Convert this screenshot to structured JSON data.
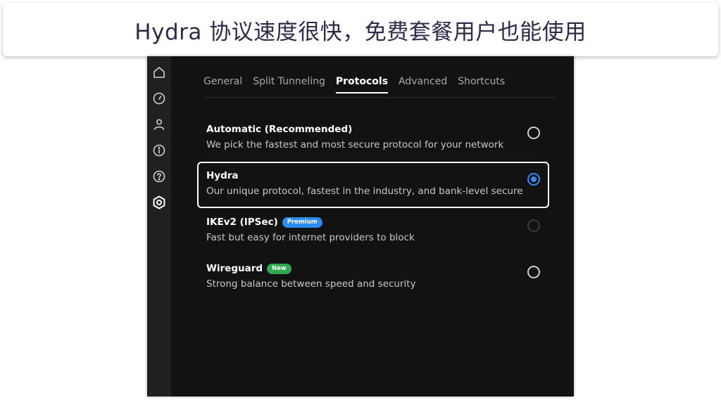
{
  "caption": {
    "text": "Hydra 协议速度很快，免费套餐用户也能使用"
  },
  "sidebar": {
    "items": [
      {
        "icon": "home-icon"
      },
      {
        "icon": "speedometer-icon"
      },
      {
        "icon": "user-icon"
      },
      {
        "icon": "info-icon"
      },
      {
        "icon": "help-icon"
      },
      {
        "icon": "settings-icon",
        "active": true
      }
    ]
  },
  "tabs": {
    "items": [
      {
        "label": "General"
      },
      {
        "label": "Split Tunneling"
      },
      {
        "label": "Protocols",
        "active": true
      },
      {
        "label": "Advanced"
      },
      {
        "label": "Shortcuts"
      }
    ]
  },
  "protocols": {
    "options": [
      {
        "name": "Automatic (Recommended)",
        "description": "We pick the fastest and most secure protocol for your network",
        "badge": "",
        "selected": false
      },
      {
        "name": "Hydra",
        "description": "Our unique protocol, fastest in the industry, and bank-level secure",
        "badge": "",
        "selected": true
      },
      {
        "name": "IKEv2 (IPSec)",
        "description": "Fast but easy for internet providers to block",
        "badge": "Premium",
        "selected": false,
        "disabled": true
      },
      {
        "name": "Wireguard",
        "description": "Strong balance between speed and security",
        "badge": "New",
        "selected": false
      }
    ]
  },
  "colors": {
    "accent": "#2d8cf0",
    "new_badge": "#2fa84f",
    "app_background": "#121212",
    "sidebar_background": "#202020"
  }
}
